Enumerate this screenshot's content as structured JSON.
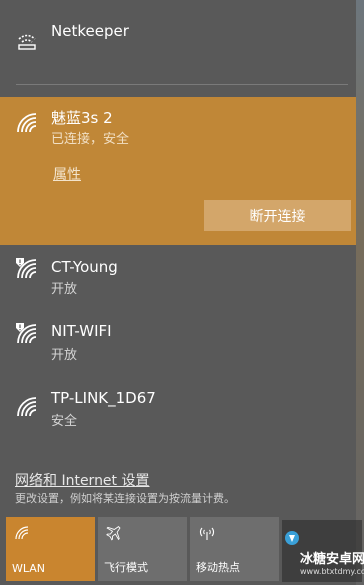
{
  "networks": [
    {
      "name": "Netkeeper",
      "status": "",
      "icon": "wired-dialup-icon"
    },
    {
      "name": "魅蓝3s 2",
      "status": "已连接，安全",
      "icon": "wifi-signal-icon"
    },
    {
      "name": "CT-Young",
      "status": "开放",
      "icon": "wifi-unsecured-icon"
    },
    {
      "name": "NIT-WIFI",
      "status": "开放",
      "icon": "wifi-unsecured-icon"
    },
    {
      "name": "TP-LINK_1D67",
      "status": "安全",
      "icon": "wifi-signal-icon"
    }
  ],
  "active_network": {
    "properties_label": "属性",
    "disconnect_label": "断开连接"
  },
  "settings": {
    "link_text": "网络和 Internet 设置",
    "description": "更改设置，例如将某连接设置为按流量计费。"
  },
  "quick_actions": [
    {
      "label": "WLAN",
      "icon": "wifi-icon",
      "active": true
    },
    {
      "label": "飞行模式",
      "icon": "airplane-icon",
      "active": false
    },
    {
      "label": "移动热点",
      "icon": "hotspot-icon",
      "active": false
    }
  ],
  "watermark": {
    "title": "冰糖安卓网",
    "url": "www.btxtdmy.com"
  },
  "colors": {
    "panel_bg": "#595959",
    "accent": "#c08737",
    "accent_button": "#d3a66a",
    "tile_active": "#c9852f",
    "tile_inactive": "#6e6e6e"
  }
}
